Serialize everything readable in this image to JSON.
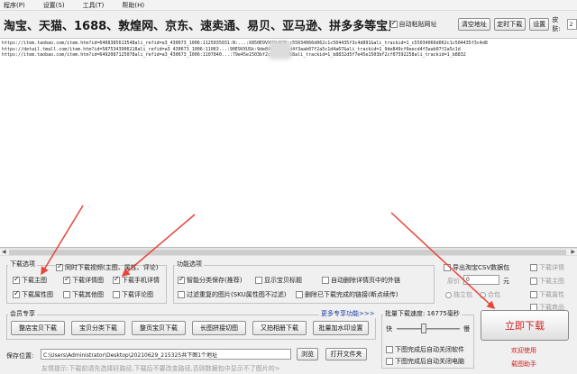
{
  "menu": [
    "程序(P)",
    "设置(S)",
    "工具(T)",
    "帮助(H)"
  ],
  "toolbar": {
    "headline": "淘宝、天猫、1688、敦煌网、京东、速卖通、易贝、亚马逊、拼多多等宝贝地址:",
    "auto_paste": "自动粘贴网址",
    "clear_button": "清空地址",
    "timer_button": "定时下载",
    "settings_button": "设置",
    "skin_label": "皮肤:",
    "skin_value": "2"
  },
  "urls": [
    "https://item.taobao.com/item.htm?id=6408385613548ali_refid=a3_430673_1006:1125035031:N:...:X850E9VXUSkN2B:c55034066d062c1c504435f3c4d891&ali_trackid=1_c55034066d062c1c504435f3c4d8",
    "https://detail.tmall.com/item.htm?id=5875343906218ali_refid=a3_430673_1006:11063...:90E9VXUSk:9de849cf0eecd4f3aab07f2a5c1d4a67&ali_trackid=1_9de849cf0eecd4f3aab07f2a5c1d",
    "https://item.taobao.com/item.htm?id=6492087125078ali_refid=a3_430673_1006:1107840...:79e45e1503bf2cf07592258ali_trackid=1_b8832d5f7e45e1503bf2cf07592258ali_trackid=1_b8832"
  ],
  "download_options": {
    "legend": "下载选项",
    "video": "同时下载视频(主图、属性、评论)",
    "main_image": "下载主图",
    "detail_image": "下载详情图",
    "mobile_detail": "下载手机详情",
    "attr_image": "下载属性图",
    "other_image": "下载其他图",
    "review_image": "下载评论图"
  },
  "function_options": {
    "legend": "功能选项",
    "smart_save": "智能分类保存(推荐)",
    "show_title": "显示宝贝标题",
    "auto_delete_links": "自动删除详情页中的外链",
    "filter_dup": "过滤重复的图片(SKU属性图不过滤)",
    "delete_done_links": "删除已下载完成的链接(断点续传)"
  },
  "export_options": {
    "export_csv": "导出淘宝CSV数据包",
    "original_price": "原价",
    "price_value": "0",
    "price_unit": "元",
    "exclusive": "独立包",
    "merge": "合包",
    "download_detail": "下载详情",
    "download_main": "下载主图",
    "download_attr": "下载属性",
    "download_product": "下载商品"
  },
  "member": {
    "legend": "会员专享",
    "more": "更多专享功能>>>",
    "buttons": [
      "整店宝贝下载",
      "宝贝分类下载",
      "整页宝贝下载",
      "长图拼接切图",
      "又拍相册下载",
      "批量加水印设置"
    ]
  },
  "speed": {
    "legend": "批量下载速度: 16775毫秒",
    "fast": "快",
    "slow": "慢",
    "shutdown": "下图完成后自动关闭软件",
    "poweroff": "下图完成后自动关闭电脑"
  },
  "save": {
    "label": "保存位置:",
    "path": "C:\\Users\\Administrator\\Desktop\\20210629_215325共下图1个地址",
    "browse": "浏览",
    "open_folder": "打开文件夹"
  },
  "tip": "友情提示:下载前请先选择好路径,下载后不要改变路径,否则数据包中显示不了图片的>",
  "download_now": "立即下载",
  "welcome": "欢迎使用",
  "app_name": "载图助手",
  "colors": {
    "accent_red": "#d02020",
    "arrow_red": "#e8443a"
  }
}
